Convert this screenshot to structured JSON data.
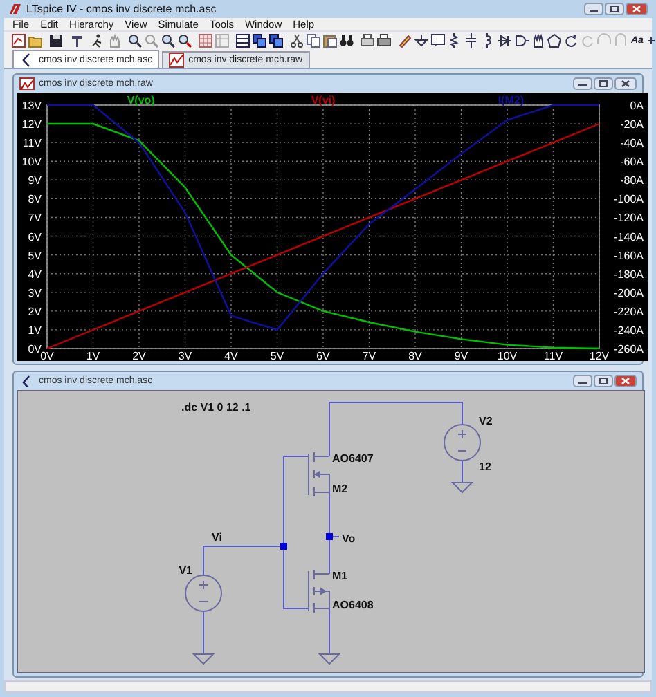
{
  "window": {
    "title": "LTspice IV - cmos inv discrete mch.asc"
  },
  "menu": [
    "File",
    "Edit",
    "Hierarchy",
    "View",
    "Simulate",
    "Tools",
    "Window",
    "Help"
  ],
  "toolbar_text": "Aa",
  "tabs": [
    {
      "label": "cmos inv discrete mch.asc",
      "kind": "schematic",
      "selected": true
    },
    {
      "label": "cmos inv discrete mch.raw",
      "kind": "waveform",
      "selected": false
    }
  ],
  "plot_window": {
    "title": "cmos inv discrete mch.raw",
    "chart_data": {
      "type": "line",
      "x": [
        0,
        1,
        2,
        3,
        4,
        5,
        6,
        7,
        8,
        9,
        10,
        11,
        12
      ],
      "xticks": [
        {
          "value": 0,
          "label": "0V"
        },
        {
          "value": 1,
          "label": "1V"
        },
        {
          "value": 2,
          "label": "2V"
        },
        {
          "value": 3,
          "label": "3V"
        },
        {
          "value": 4,
          "label": "4V"
        },
        {
          "value": 5,
          "label": "5V"
        },
        {
          "value": 6,
          "label": "6V"
        },
        {
          "value": 7,
          "label": "7V"
        },
        {
          "value": 8,
          "label": "8V"
        },
        {
          "value": 9,
          "label": "9V"
        },
        {
          "value": 10,
          "label": "10V"
        },
        {
          "value": 11,
          "label": "11V"
        },
        {
          "value": 12,
          "label": "12V"
        }
      ],
      "yticks": [
        {
          "value": 0,
          "label": "0V"
        },
        {
          "value": 1,
          "label": "1V"
        },
        {
          "value": 2,
          "label": "2V"
        },
        {
          "value": 3,
          "label": "3V"
        },
        {
          "value": 4,
          "label": "4V"
        },
        {
          "value": 5,
          "label": "5V"
        },
        {
          "value": 6,
          "label": "6V"
        },
        {
          "value": 7,
          "label": "7V"
        },
        {
          "value": 8,
          "label": "8V"
        },
        {
          "value": 9,
          "label": "9V"
        },
        {
          "value": 10,
          "label": "10V"
        },
        {
          "value": 11,
          "label": "11V"
        },
        {
          "value": 12,
          "label": "12V"
        },
        {
          "value": 13,
          "label": "13V"
        }
      ],
      "xlim": [
        0,
        12
      ],
      "ylim": [
        0,
        13
      ],
      "y2lim": [
        -260,
        0
      ],
      "grid": true,
      "y2ticks": [
        {
          "value": 0,
          "label": "0A"
        },
        {
          "value": -20,
          "label": "-20A"
        },
        {
          "value": -40,
          "label": "-40A"
        },
        {
          "value": -60,
          "label": "-60A"
        },
        {
          "value": -80,
          "label": "-80A"
        },
        {
          "value": -100,
          "label": "-100A"
        },
        {
          "value": -120,
          "label": "-120A"
        },
        {
          "value": -140,
          "label": "-140A"
        },
        {
          "value": -160,
          "label": "-160A"
        },
        {
          "value": -180,
          "label": "-180A"
        },
        {
          "value": -200,
          "label": "-200A"
        },
        {
          "value": -220,
          "label": "-220A"
        },
        {
          "value": -240,
          "label": "-240A"
        },
        {
          "value": -260,
          "label": "-260A"
        }
      ],
      "series": [
        {
          "name": "V(vo)",
          "color": "#00c000",
          "values": [
            12,
            12,
            11.1,
            8.6,
            5,
            3,
            2,
            1.4,
            0.9,
            0.5,
            0.2,
            0.05,
            0
          ]
        },
        {
          "name": "V(vi)",
          "color": "#c00000",
          "values": [
            0,
            1,
            2,
            3,
            4,
            5,
            6,
            7,
            8,
            9,
            10,
            11,
            12
          ]
        },
        {
          "name": "I(M2)",
          "color": "#1010a0",
          "axis": "y2",
          "values": [
            0,
            0,
            -40,
            -115,
            -225,
            -240,
            -180,
            -127,
            -90,
            -52,
            -16,
            0,
            0
          ]
        }
      ]
    }
  },
  "schematic_window": {
    "title": "cmos inv discrete mch.asc",
    "directive": ".dc V1 0 12 .1",
    "components": [
      {
        "kind": "pmos",
        "name": "M2",
        "model": "AO6407"
      },
      {
        "kind": "nmos",
        "name": "M1",
        "model": "AO6408"
      },
      {
        "kind": "voltage_source",
        "name": "V2",
        "value": "12"
      },
      {
        "kind": "voltage_source",
        "name": "V1"
      }
    ],
    "net_labels": [
      "Vi",
      "Vo"
    ]
  }
}
